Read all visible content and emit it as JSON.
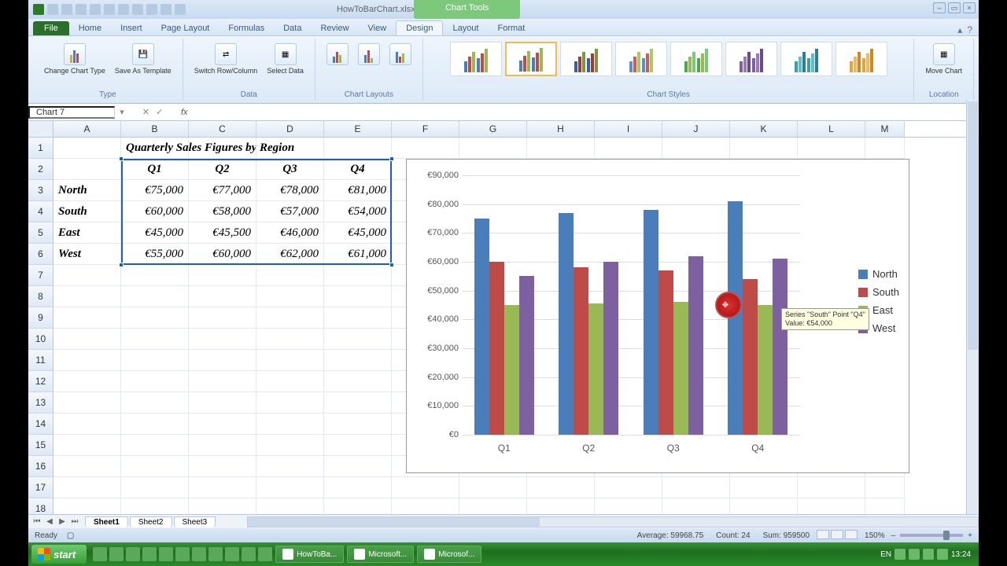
{
  "title_bar": {
    "filename": "HowToBarChart.xlsx - Microsoft Excel",
    "chart_tools": "Chart Tools"
  },
  "tabs": {
    "file": "File",
    "list": [
      "Home",
      "Insert",
      "Page Layout",
      "Formulas",
      "Data",
      "Review",
      "View"
    ],
    "ctx": [
      "Design",
      "Layout",
      "Format"
    ],
    "active": "Design"
  },
  "ribbon": {
    "type_group": "Type",
    "change_type": "Change\nChart Type",
    "save_template": "Save As\nTemplate",
    "data_group": "Data",
    "switch": "Switch\nRow/Column",
    "select_data": "Select\nData",
    "layouts_group": "Chart Layouts",
    "styles_group": "Chart Styles",
    "location_group": "Location",
    "move_chart": "Move\nChart"
  },
  "formula": {
    "name_box": "Chart 7",
    "fx": "fx",
    "value": ""
  },
  "columns": [
    "A",
    "B",
    "C",
    "D",
    "E",
    "F",
    "G",
    "H",
    "I",
    "J",
    "K",
    "L",
    "M"
  ],
  "rows": [
    "1",
    "2",
    "3",
    "4",
    "5",
    "6",
    "7",
    "8",
    "9",
    "10",
    "11",
    "12",
    "13",
    "14",
    "15",
    "16",
    "17",
    "18"
  ],
  "table": {
    "title": "Quarterly Sales Figures by Region",
    "headers": [
      "Q1",
      "Q2",
      "Q3",
      "Q4"
    ],
    "regions": [
      "North",
      "South",
      "East",
      "West"
    ],
    "values": [
      [
        "€75,000",
        "€77,000",
        "€78,000",
        "€81,000"
      ],
      [
        "€60,000",
        "€58,000",
        "€57,000",
        "€54,000"
      ],
      [
        "€45,000",
        "€45,500",
        "€46,000",
        "€45,000"
      ],
      [
        "€55,000",
        "€60,000",
        "€62,000",
        "€61,000"
      ]
    ]
  },
  "chart_data": {
    "type": "bar",
    "categories": [
      "Q1",
      "Q2",
      "Q3",
      "Q4"
    ],
    "series": [
      {
        "name": "North",
        "values": [
          75000,
          77000,
          78000,
          81000
        ],
        "color": "#4a7ebb"
      },
      {
        "name": "South",
        "values": [
          60000,
          58000,
          57000,
          54000
        ],
        "color": "#be4b48"
      },
      {
        "name": "East",
        "values": [
          45000,
          45500,
          46000,
          45000
        ],
        "color": "#98b954"
      },
      {
        "name": "West",
        "values": [
          55000,
          60000,
          62000,
          61000
        ],
        "color": "#7d60a0"
      }
    ],
    "ylabel": "",
    "xlabel": "",
    "ylim": [
      0,
      90000
    ],
    "y_ticks": [
      "€0",
      "€10,000",
      "€20,000",
      "€30,000",
      "€40,000",
      "€50,000",
      "€60,000",
      "€70,000",
      "€80,000",
      "€90,000"
    ],
    "tooltip": "Series \"South\" Point \"Q4\"\nValue: €54,000"
  },
  "sheets": {
    "list": [
      "Sheet1",
      "Sheet2",
      "Sheet3"
    ],
    "active": "Sheet1"
  },
  "status": {
    "ready": "Ready",
    "average": "Average: 59968.75",
    "count": "Count: 24",
    "sum": "Sum: 959500",
    "zoom": "150%"
  },
  "taskbar": {
    "start": "start",
    "items": [
      "HowToBa...",
      "Microsoft...",
      "Microsof..."
    ],
    "lang": "EN",
    "time": "13:24"
  }
}
